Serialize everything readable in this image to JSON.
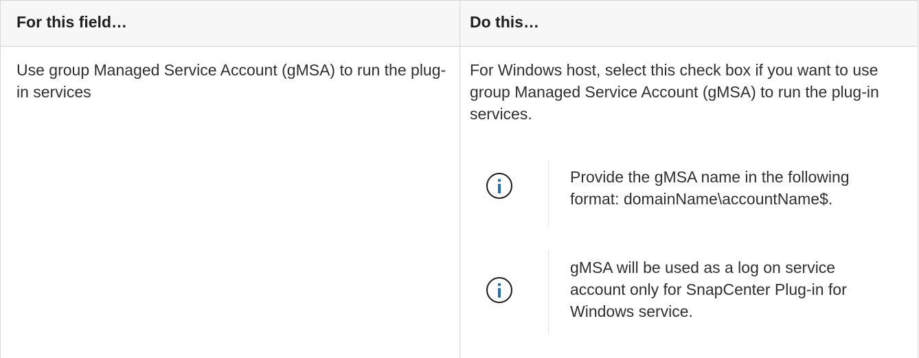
{
  "table": {
    "headers": [
      "For this field…",
      "Do this…"
    ],
    "rows": [
      {
        "field": "Use group Managed Service Account (gMSA) to run the plug-in services",
        "action": "For Windows host, select this check box if you want to use group Managed Service Account (gMSA) to run the plug-in services.",
        "notes": [
          {
            "icon": "info-icon",
            "text": "Provide the gMSA name in the following format: domainName\\accountName$."
          },
          {
            "icon": "info-icon",
            "text": "gMSA will be used as a log on service account only for SnapCenter Plug-in for Windows service."
          }
        ]
      }
    ]
  },
  "colors": {
    "header_bg": "#f7f7f7",
    "border": "#d6d6d6",
    "info_accent": "#1f6fb5"
  }
}
